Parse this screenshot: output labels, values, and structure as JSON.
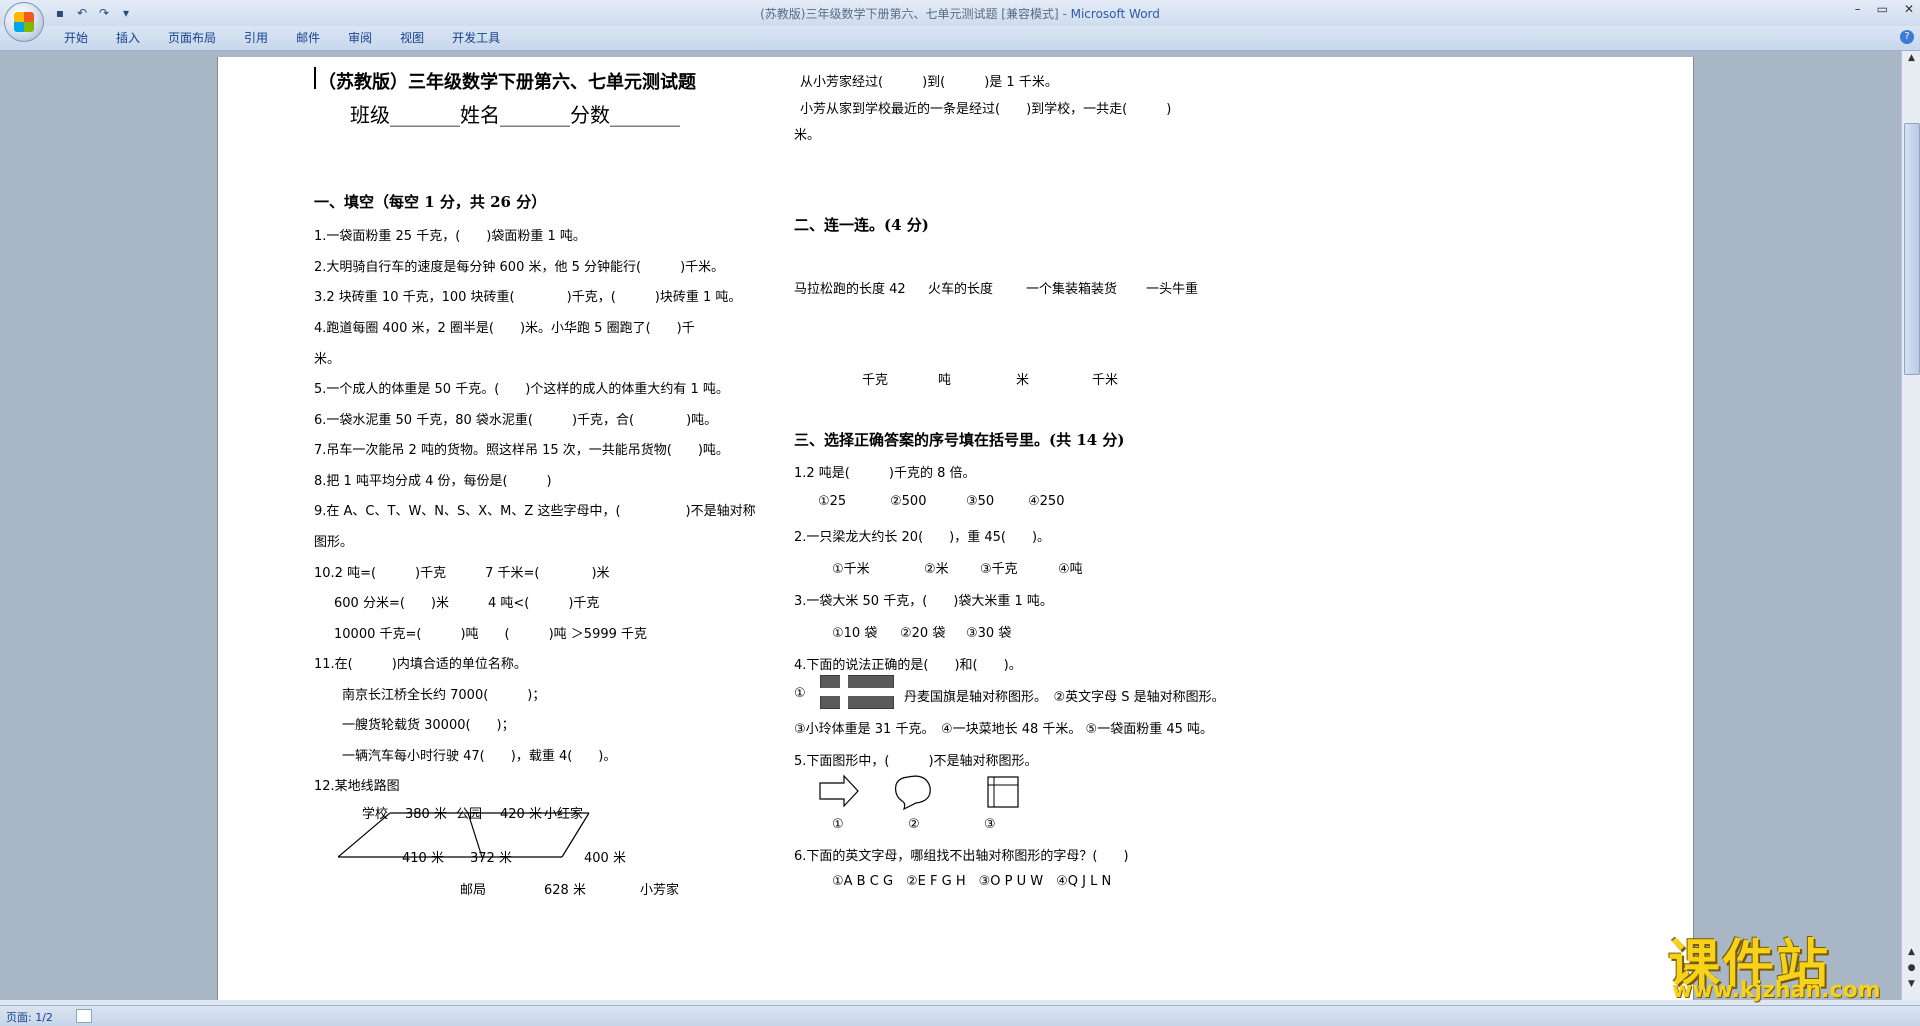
{
  "window": {
    "title": "(苏教版)三年级数学下册第六、七单元测试题 [兼容模式] - ",
    "app": "Microsoft Word"
  },
  "qat": [
    "save-icon",
    "undo-icon",
    "redo-icon",
    "customize-icon"
  ],
  "tabs": [
    "开始",
    "插入",
    "页面布局",
    "引用",
    "邮件",
    "审阅",
    "视图",
    "开发工具"
  ],
  "doc": {
    "title": "（苏教版）三年级数学下册第六、七单元测试题",
    "subtitle": "班级_______姓名_______分数_______",
    "sec1": "一、填空（每空 1 分，共 26 分）",
    "q1": "1.一袋面粉重 25 千克，(　　)袋面粉重 1 吨。",
    "q2": "2.大明骑自行车的速度是每分钟 600 米，他 5 分钟能行(　　　)千米。",
    "q3": "3.2 块砖重 10 千克，100 块砖重(　　　　)千克，(　　　)块砖重 1 吨。",
    "q4a": "4.跑道每圈 400 米，2 圈半是(　　)米。小华跑 5 圈跑了(　　)千",
    "q4b": "米。",
    "q5": "5.一个成人的体重是 50 千克。(　　)个这样的成人的体重大约有 1 吨。",
    "q6": "6.一袋水泥重 50 千克，80 袋水泥重(　　　)千克，合(　　　　)吨。",
    "q7": "7.吊车一次能吊 2 吨的货物。照这样吊 15 次，一共能吊货物(　　)吨。",
    "q8": "8.把 1 吨平均分成 4 份，每份是(　　　)",
    "q9a": "9.在 A、C、T、W、N、S、X、M、Z 这些字母中，(　　　　　)不是轴对称",
    "q9b": "图形。",
    "q10a": "10.2 吨=(　　　)千克　　　7 千米=(　　　　)米",
    "q10b": "600 分米=(　　)米　　　4 吨<(　　　)千克",
    "q10c": "10000 千克=(　　　)吨　　(　　　)吨 ＞5999 千克",
    "q11": "11.在(　　　)内填合适的单位名称。",
    "q11a": "南京长江桥全长约 7000(　　　)；",
    "q11b": "一艘货轮载货 30000(　　)；",
    "q11c": "一辆汽车每小时行驶 47(　　)，载重 4(　　)。",
    "q12": "12.某地线路图",
    "route": {
      "school": "学校",
      "d1": "380 米",
      "park": "公园",
      "d2": "420 米",
      "xiaohong": "小红家",
      "d3": "410 米",
      "d4": "372 米",
      "d5": "400 米",
      "post": "邮局",
      "d6": "628 米",
      "xiaofang": "小芳家"
    },
    "r1": "从小芳家经过(　　　)到(　　　)是 1 千米。",
    "r2": "小芳从家到学校最近的一条是经过(　　)到学校，一共走(　　　)",
    "r3": "米。",
    "sec2": "二、连一连。(4 分)",
    "match_top": [
      "马拉松跑的长度 42",
      "火车的长度",
      "一个集装箱装货",
      "一头牛重"
    ],
    "match_bottom": [
      "千克",
      "吨",
      "米",
      "千米"
    ],
    "sec3": "三、选择正确答案的序号填在括号里。(共 14 分)",
    "c1": "1.2 吨是(　　　)千克的 8 倍。",
    "c1o": [
      "①25",
      "②500",
      "③50",
      "④250"
    ],
    "c2": "2.一只梁龙大约长 20(　　)，重 45(　　)。",
    "c2o": [
      "①千米",
      "②米",
      "③千克",
      "④吨"
    ],
    "c3": "3.一袋大米 50 千克，(　　)袋大米重 1 吨。",
    "c3o": [
      "①10 袋",
      "②20 袋",
      "③30 袋"
    ],
    "c4": "4.下面的说法正确的是(　　)和(　　)。",
    "c4a_num": "①",
    "c4a": "丹麦国旗是轴对称图形。　②英文字母 S 是轴对称图形。",
    "c4b": "③小玲体重是 31 千克。　④一块菜地长 48 千米。 ⑤一袋面粉重 45 吨。",
    "c5": "5.下面图形中，(　　　)不是轴对称图形。",
    "c5o": [
      "①",
      "②",
      "③"
    ],
    "c6": "6.下面的英文字母，哪组找不出轴对称图形的字母？(　　)",
    "c6o": "①A B C G　②E F G H　③O P U W　④Q J L N"
  },
  "status": {
    "page": "页面: 1/2"
  },
  "watermark": {
    "cn": "课件站",
    "url": "www.kjzhan.com"
  }
}
